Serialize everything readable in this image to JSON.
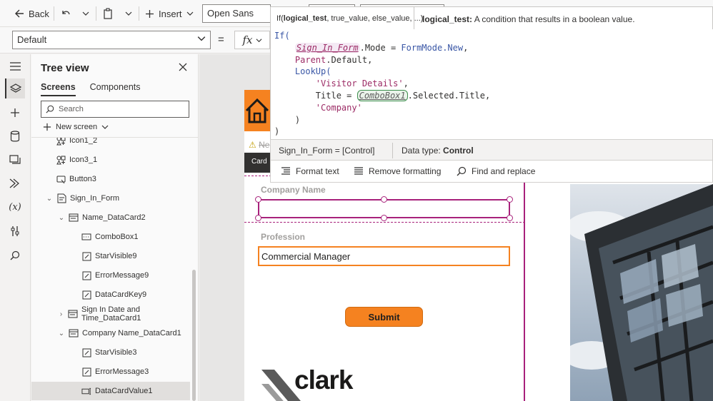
{
  "toolbar": {
    "back_label": "Back",
    "insert_label": "Insert",
    "font_value": "Open Sans"
  },
  "formula_bar": {
    "property_value": "Default",
    "equals": "=",
    "fx_label": "fx"
  },
  "function_hint": {
    "fn_name": "If(",
    "param_bold": "logical_test",
    "param_rest": ", true_value, else_value, ...)",
    "hint_param": "logical_test:",
    "hint_text": " A condition that results in a boolean value."
  },
  "code": {
    "line1": "If(",
    "l2_ctrl": "Sign_In_Form",
    "l2_mid": ".Mode = ",
    "l2_enum": "FormMode.New",
    "l2_end": ",",
    "l3_parent": "Parent",
    "l3_rest": ".Default,",
    "l4": "LookUp(",
    "l5_str": "'Visitor Details'",
    "l5_end": ",",
    "l6_pre": "Title = ",
    "l6_ctrl": "ComboBox1",
    "l6_rest": ".Selected.Title,",
    "l7_str": "'Company'",
    "l8": ")",
    "l9": ")"
  },
  "info_bar": {
    "expression": "Sign_In_Form  =  [Control]",
    "data_type_label": "Data type: ",
    "data_type_value": "Control"
  },
  "actions": {
    "format_text": "Format text",
    "remove_formatting": "Remove formatting",
    "find_replace": "Find and replace"
  },
  "tree": {
    "title": "Tree view",
    "tab_screens": "Screens",
    "tab_components": "Components",
    "search_placeholder": "Search",
    "new_screen": "New screen",
    "nodes": [
      {
        "label": "Icon1_2",
        "icon": "icon-shapes-icon"
      },
      {
        "label": "Icon3_1",
        "icon": "icon-shapes-icon"
      },
      {
        "label": "Button3",
        "icon": "button-icon"
      },
      {
        "label": "Sign_In_Form",
        "icon": "form-icon"
      },
      {
        "label": "Name_DataCard2",
        "icon": "card-icon"
      },
      {
        "label": "ComboBox1",
        "icon": "combobox-icon"
      },
      {
        "label": "StarVisible9",
        "icon": "label-icon"
      },
      {
        "label": "ErrorMessage9",
        "icon": "label-icon"
      },
      {
        "label": "DataCardKey9",
        "icon": "label-icon"
      },
      {
        "label": "Sign In Date and Time_DataCard1",
        "icon": "card-icon"
      },
      {
        "label": "Company Name_DataCard1",
        "icon": "card-icon"
      },
      {
        "label": "StarVisible3",
        "icon": "label-icon"
      },
      {
        "label": "ErrorMessage3",
        "icon": "label-icon"
      },
      {
        "label": "DataCardValue1",
        "icon": "textinput-icon"
      }
    ]
  },
  "canvas": {
    "warning_text": "Ne",
    "card_tip": "Card",
    "company_label": "Company Name",
    "profession_label": "Profession",
    "profession_value": "Commercial Manager",
    "submit_label": "Submit",
    "logo_text": "clark"
  },
  "colors": {
    "accent_orange": "#f58220",
    "selection_magenta": "#a8217b"
  }
}
